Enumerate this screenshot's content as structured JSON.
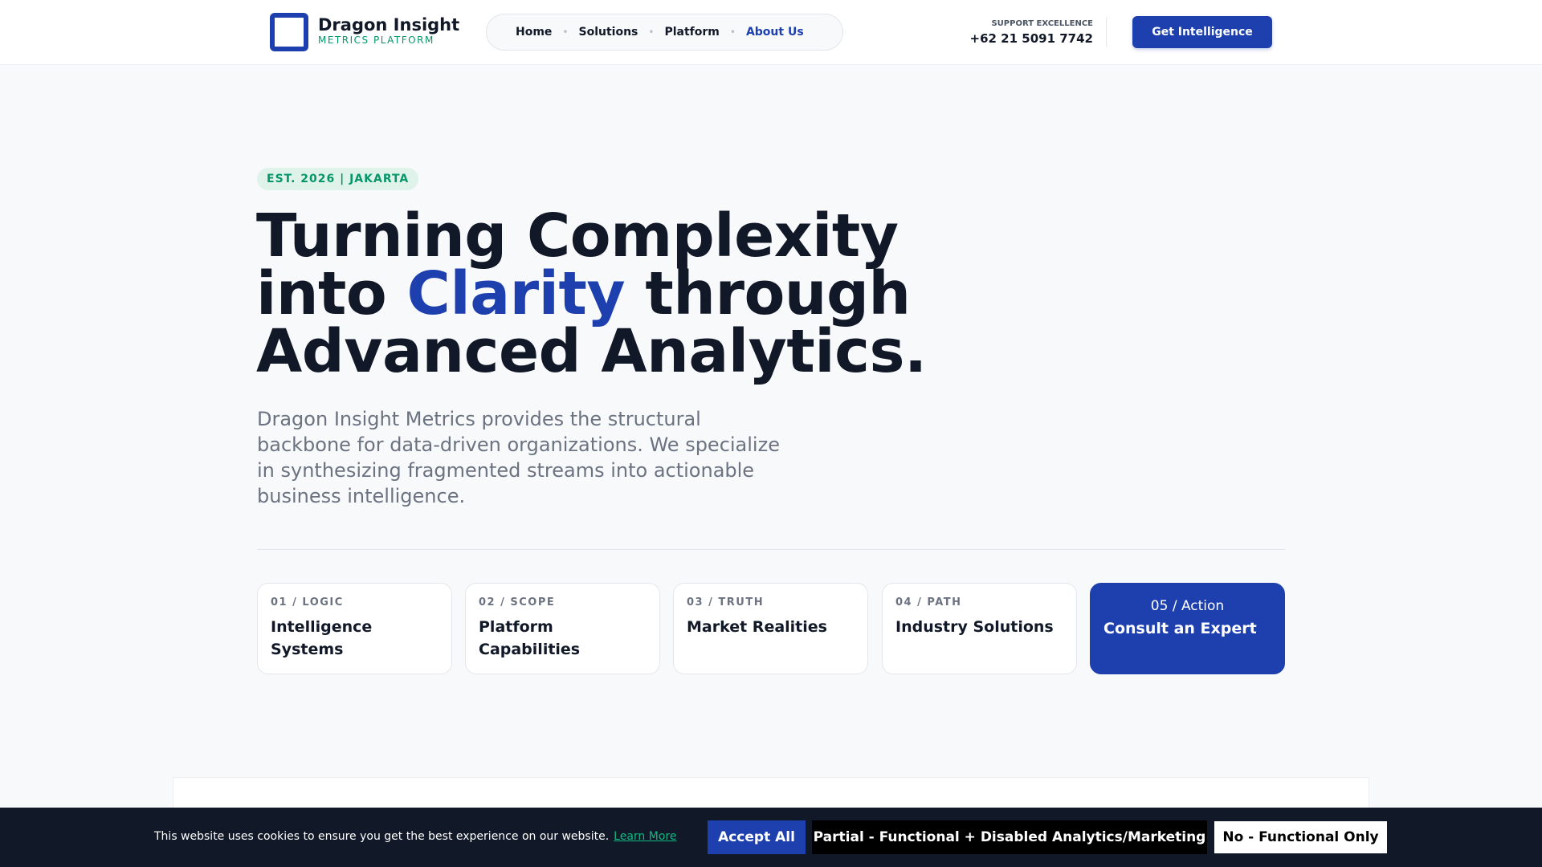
{
  "brand": {
    "name": "Dragon Insight",
    "tagline": "METRICS PLATFORM",
    "accent_color": "#1e40af",
    "secondary_color": "#059669"
  },
  "nav": {
    "items": [
      {
        "label": "Home"
      },
      {
        "label": "Solutions"
      },
      {
        "label": "Platform"
      },
      {
        "label": "About Us"
      }
    ],
    "active": "About Us"
  },
  "support": {
    "label": "SUPPORT EXCELLENCE",
    "phone": "+62 21 5091 7742"
  },
  "header_cta": "Get Intelligence",
  "hero": {
    "badge": "EST. 2026 | JAKARTA",
    "headline_part1": "Turning Complexity into ",
    "headline_accent": "Clarity",
    "headline_part2": " through Advanced Analytics.",
    "lead": "Dragon Insight Metrics provides the structural backbone for data-driven organizations. We specialize in synthesizing fragmented streams into actionable business intelligence."
  },
  "cards": [
    {
      "num": "01 / LOGIC",
      "title": "Intelligence Systems"
    },
    {
      "num": "02 / SCOPE",
      "title": "Platform Capabilities"
    },
    {
      "num": "03 / TRUTH",
      "title": "Market Realities"
    },
    {
      "num": "04 / PATH",
      "title": "Industry Solutions"
    },
    {
      "num": "05 / Action",
      "title": "Consult an Expert"
    }
  ],
  "cookie": {
    "message": "This website uses cookies to ensure you get the best experience on our website.",
    "learn_more": "Learn More",
    "accept_all": "Accept All",
    "partial": "Partial - Functional + Disabled Analytics/Marketing",
    "functional_only": "No - Functional Only"
  }
}
